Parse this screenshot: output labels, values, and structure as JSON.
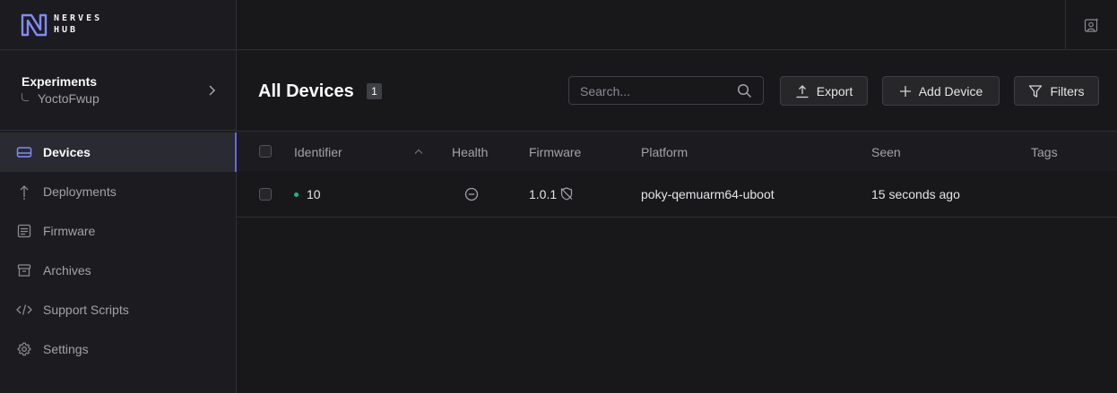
{
  "brand": {
    "line1": "NERVES",
    "line2": "HUB"
  },
  "org": {
    "name": "Experiments",
    "product": "YoctoFwup"
  },
  "nav": [
    {
      "label": "Devices",
      "icon": "devices-icon",
      "active": true
    },
    {
      "label": "Deployments",
      "icon": "deployments-icon"
    },
    {
      "label": "Firmware",
      "icon": "firmware-icon"
    },
    {
      "label": "Archives",
      "icon": "archives-icon"
    },
    {
      "label": "Support Scripts",
      "icon": "code-icon"
    },
    {
      "label": "Settings",
      "icon": "gear-icon"
    }
  ],
  "header": {
    "title": "All Devices",
    "count": "1",
    "search_placeholder": "Search...",
    "export_label": "Export",
    "add_device_label": "Add Device",
    "filters_label": "Filters"
  },
  "table": {
    "columns": [
      "Identifier",
      "Health",
      "Firmware",
      "Platform",
      "Seen",
      "Tags"
    ],
    "rows": [
      {
        "identifier": "10",
        "status_color": "#10b981",
        "health": "unknown",
        "firmware": "1.0.1",
        "platform": "poky-qemuarm64-uboot",
        "seen": "15 seconds ago",
        "tags": ""
      }
    ]
  },
  "colors": {
    "accent": "#6366f1",
    "online": "#10b981",
    "background": "#18181b"
  }
}
